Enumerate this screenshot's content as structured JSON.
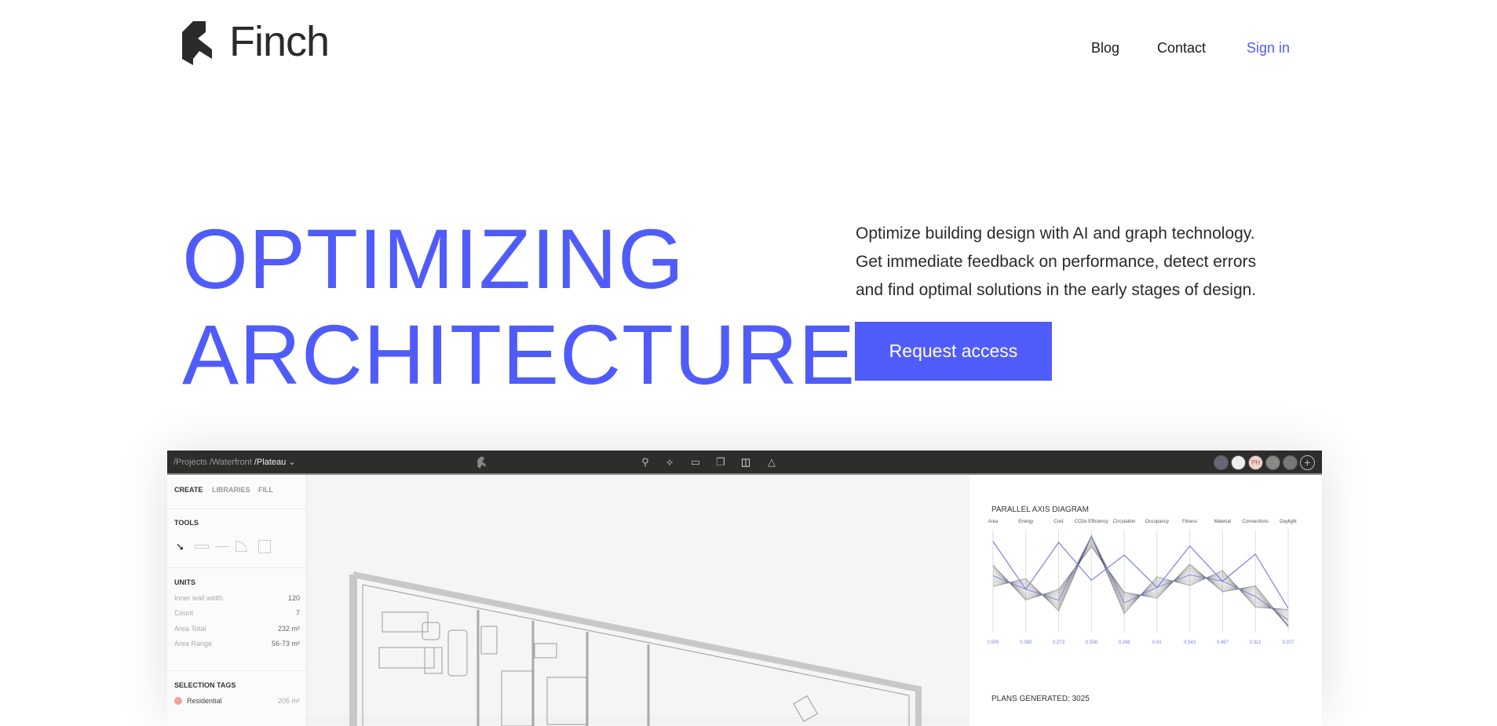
{
  "header": {
    "brand": "Finch",
    "nav": [
      "Blog",
      "Contact",
      "Sign in"
    ]
  },
  "hero": {
    "title_lines": [
      "OPTIMIZING",
      "ARCHITECTURE"
    ],
    "description_lines": [
      "Optimize building design with AI and graph technology.",
      "Get immediate feedback on performance, detect errors",
      "and find optimal solutions in the early stages of design."
    ],
    "cta": "Request access"
  },
  "colors": {
    "accent": "#505cfa",
    "text": "#2b2b2b",
    "app_bar": "#2d2e2c"
  },
  "app": {
    "breadcrumb": [
      "/Projects",
      "/Waterfront",
      "/Plateau"
    ],
    "toolbar_icons": [
      "location-pin-icon",
      "graph-icon",
      "monitor-icon",
      "copy-icon",
      "layout-icon",
      "triangle-icon"
    ],
    "avatars": [
      "user-1",
      "user-2",
      "PH",
      "user-4",
      "user-5"
    ],
    "left_tabs": [
      "CREATE",
      "LIBRARIES",
      "FILL"
    ],
    "tools_title": "TOOLS",
    "units_title": "UNITS",
    "units": [
      {
        "label": "Inner wall width",
        "value": "120"
      },
      {
        "label": "Count",
        "value": "7"
      },
      {
        "label": "Area Total",
        "value": "232 m²"
      },
      {
        "label": "Area Range",
        "value": "56-73 m²"
      }
    ],
    "selection_tags_title": "SELECTION TAGS",
    "tags": [
      {
        "label": "Residential",
        "value": "205 m²",
        "color": "#f2a0a0"
      }
    ],
    "plans_generated": "PLANS GENERATED: 3025"
  },
  "chart_data": {
    "type": "line",
    "title": "PARALLEL AXIS DIAGRAM",
    "axes": [
      "Area",
      "Energy",
      "Cost",
      "CO2e Efficiency",
      "Circulation",
      "Occupancy",
      "Fitness",
      "Material",
      "Connections",
      "Daylight"
    ],
    "axis_values": [
      "0.509",
      "0.380",
      "0.273",
      "0.538",
      "0.248",
      "0.41",
      "0.543",
      "0.467",
      "0.312",
      "0.077"
    ],
    "series": [
      {
        "values": [
          0.94,
          0.41,
          0.93,
          0.51,
          0.79,
          0.43,
          0.89,
          0.5,
          0.8,
          0.2
        ],
        "color": "#7b7fe0"
      },
      {
        "values": [
          0.56,
          0.41,
          0.29,
          1.0,
          0.26,
          0.43,
          0.57,
          0.5,
          0.33,
          0.07
        ],
        "color": "#8a8fd8"
      }
    ],
    "ylim": [
      0,
      1
    ]
  }
}
